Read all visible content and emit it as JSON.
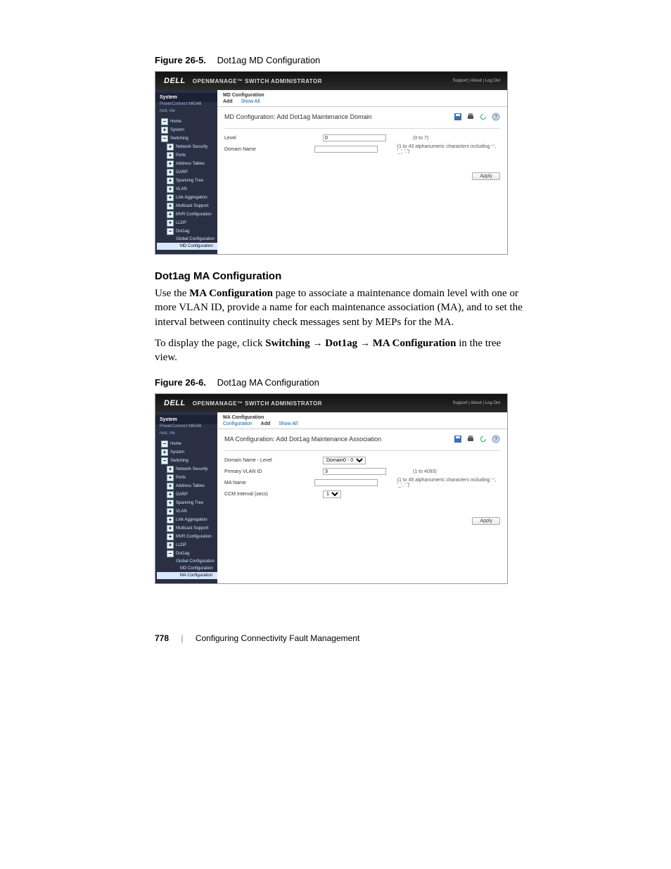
{
  "figure1": {
    "caption_label": "Figure 26-5.",
    "caption_title": "Dot1ag MD Configuration",
    "brand": "DELL",
    "app_title": "OPENMANAGE™ SWITCH ADMINISTRATOR",
    "top_links": "Support | About | Log Out",
    "side_head": "System",
    "side_sub1": "PowerConnect M6348",
    "side_sub2": "root, r/w",
    "tree": {
      "home": "Home",
      "system": "System",
      "switching": "Switching",
      "network_security": "Network Security",
      "ports": "Ports",
      "address_tables": "Address Tables",
      "garp": "GARP",
      "spanning_tree": "Spanning Tree",
      "vlan": "VLAN",
      "link_agg": "Link Aggregation",
      "multicast": "Multicast Support",
      "mvr": "MVR Configuration",
      "lldp": "LLDP",
      "dot1ag": "Dot1ag",
      "global": "Global Configuration",
      "md_conf": "MD Configuration"
    },
    "tab_title": "MD Configuration",
    "tabs": {
      "add": "Add",
      "show_all": "Show All"
    },
    "panel_title": "MD Configuration: Add Dot1ag Maintenance Domain",
    "fields": {
      "level_label": "Level",
      "level_value": "0",
      "level_hint": "(0 to 7)",
      "domain_label": "Domain Name",
      "domain_value": "",
      "domain_hint": "(1 to 43 alphanumeric characters including '-', '_', '.')"
    },
    "apply": "Apply"
  },
  "section": {
    "heading": "Dot1ag MA Configuration",
    "p1_a": "Use the ",
    "p1_b": "MA Configuration",
    "p1_c": " page to associate a maintenance domain level with one or more VLAN ID, provide a name for each maintenance association (MA), and to set the interval between continuity check messages sent by MEPs for the MA.",
    "p2_a": "To display the page, click ",
    "p2_sw": "Switching",
    "p2_d1": "Dot1ag",
    "p2_ma": "MA Configuration",
    "p2_c": " in the tree view."
  },
  "figure2": {
    "caption_label": "Figure 26-6.",
    "caption_title": "Dot1ag MA Configuration",
    "brand": "DELL",
    "app_title": "OPENMANAGE™ SWITCH ADMINISTRATOR",
    "top_links": "Support | About | Log Out",
    "side_head": "System",
    "side_sub1": "PowerConnect M6348",
    "side_sub2": "root, r/w",
    "tree": {
      "home": "Home",
      "system": "System",
      "switching": "Switching",
      "network_security": "Network Security",
      "ports": "Ports",
      "address_tables": "Address Tables",
      "garp": "GARP",
      "spanning_tree": "Spanning Tree",
      "vlan": "VLAN",
      "link_agg": "Link Aggregation",
      "multicast": "Multicast Support",
      "mvr": "MVR Configuration",
      "lldp": "LLDP",
      "dot1ag": "Dot1ag",
      "global": "Global Configuration",
      "md_conf": "MD Configuration",
      "ma_conf": "MA Configuration"
    },
    "tab_title": "MA Configuration",
    "tabs": {
      "configuration": "Configuration",
      "add": "Add",
      "show_all": "Show All"
    },
    "panel_title": "MA Configuration: Add Dot1ag Maintenance Association",
    "fields": {
      "domain_label": "Domain Name - Level",
      "domain_value": "Domain0 - 0",
      "vlan_label": "Primary VLAN ID",
      "vlan_value": "3",
      "vlan_hint": "(1 to 4093)",
      "ma_label": "MA Name",
      "ma_value": "",
      "ma_hint": "(1 to 45 alphanumeric characters including '-', '_', '.')",
      "ccm_label": "CCM Interval (secs)",
      "ccm_value": "1"
    },
    "apply": "Apply"
  },
  "footer": {
    "page": "778",
    "title": "Configuring Connectivity Fault Management"
  }
}
